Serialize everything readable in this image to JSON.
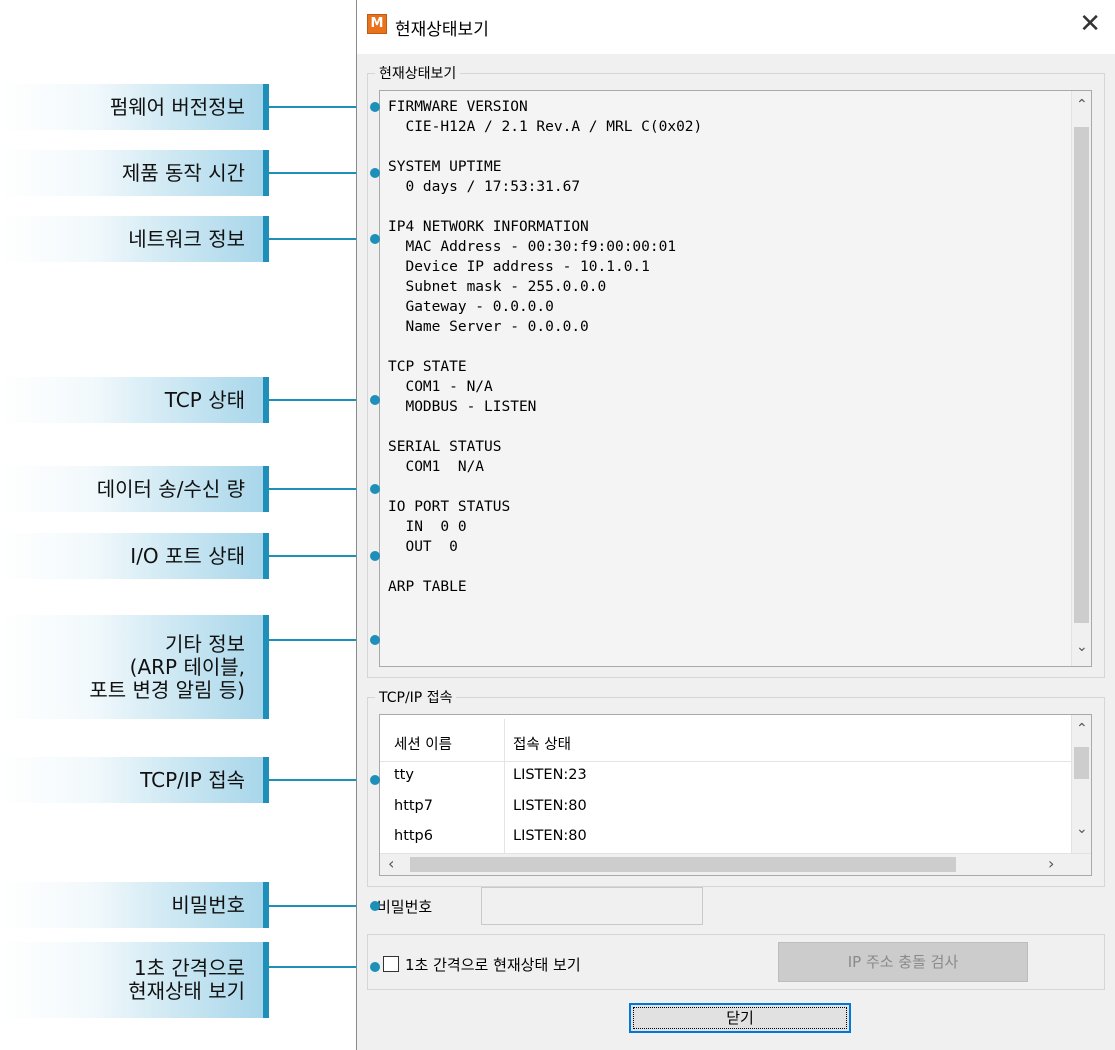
{
  "callouts": [
    {
      "lines": [
        "펌웨어 버전정보"
      ]
    },
    {
      "lines": [
        "제품 동작 시간"
      ]
    },
    {
      "lines": [
        "네트워크 정보"
      ]
    },
    {
      "lines": [
        "TCP 상태"
      ]
    },
    {
      "lines": [
        "데이터 송/수신 량"
      ]
    },
    {
      "lines": [
        "I/O 포트 상태"
      ]
    },
    {
      "lines": [
        "기타 정보",
        "(ARP 테이블,",
        "포트 변경 알림 등)"
      ]
    },
    {
      "lines": [
        "TCP/IP 접속"
      ]
    },
    {
      "lines": [
        "비밀번호"
      ]
    },
    {
      "lines": [
        "1초 간격으로",
        "현재상태 보기"
      ]
    }
  ],
  "window": {
    "icon_letter": "M",
    "title": "현재상태보기",
    "close_glyph": "✕"
  },
  "status_group": {
    "label": "현재상태보기",
    "text": "FIRMWARE VERSION\n  CIE-H12A / 2.1 Rev.A / MRL C(0x02)\n\nSYSTEM UPTIME\n  0 days / 17:53:31.67\n\nIP4 NETWORK INFORMATION\n  MAC Address - 00:30:f9:00:00:01\n  Device IP address - 10.1.0.1\n  Subnet mask - 255.0.0.0\n  Gateway - 0.0.0.0\n  Name Server - 0.0.0.0\n\nTCP STATE\n  COM1 - N/A\n  MODBUS - LISTEN\n\nSERIAL STATUS\n  COM1  N/A\n\nIO PORT STATUS\n  IN  0 0\n  OUT  0\n\nARP TABLE"
  },
  "tcp_group": {
    "label": "TCP/IP 접속",
    "columns": [
      "세션 이름",
      "접속 상태"
    ],
    "rows": [
      [
        "tty",
        "LISTEN:23"
      ],
      [
        "http7",
        "LISTEN:80"
      ],
      [
        "http6",
        "LISTEN:80"
      ]
    ]
  },
  "password": {
    "label": "비밀번호",
    "value": ""
  },
  "auto_refresh": {
    "label": "1초 간격으로 현재상태 보기",
    "checked": false
  },
  "ip_conflict_button": "IP 주소 충돌 검사",
  "close_button": "닫기",
  "colors": {
    "callout_accent": "#1d8fb8",
    "app_icon": "#e8731c"
  }
}
